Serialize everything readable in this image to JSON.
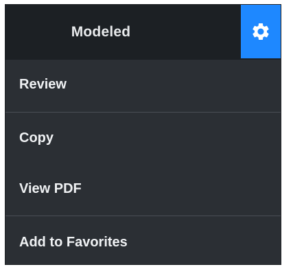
{
  "header": {
    "title": "Modeled",
    "settings_icon": "gear-icon",
    "accent_color": "#1e88ff"
  },
  "menu": {
    "items": [
      {
        "label": "Review"
      },
      {
        "label": "Copy"
      },
      {
        "label": "View PDF"
      },
      {
        "label": "Add to Favorites"
      }
    ]
  }
}
